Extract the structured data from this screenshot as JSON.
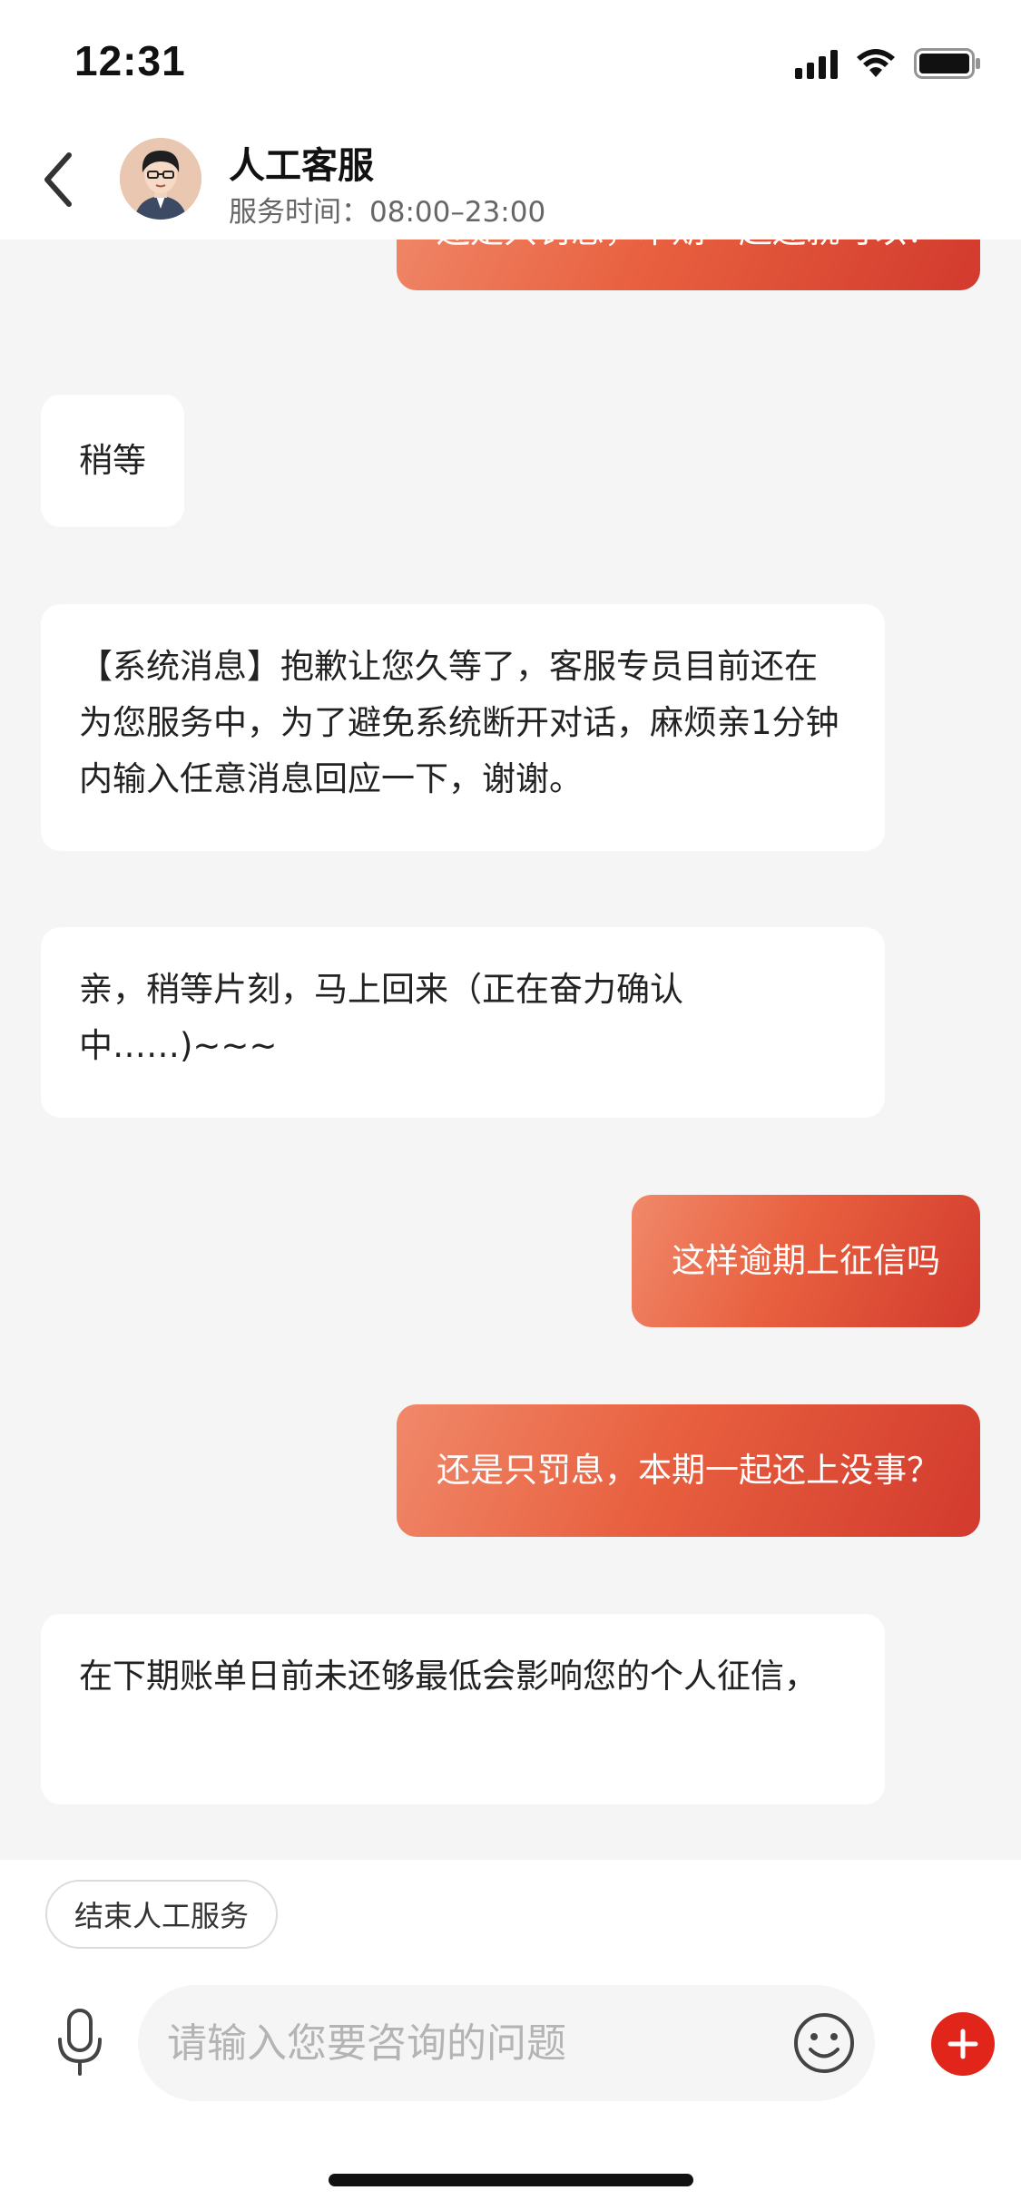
{
  "status_bar": {
    "time": "12:31"
  },
  "header": {
    "title": "人工客服",
    "service_hours": "服务时间：08:00–23:00"
  },
  "messages": [
    {
      "side": "right",
      "text": "还是只罚息，本期一起还就可以？"
    },
    {
      "side": "left",
      "text": "稍等"
    },
    {
      "side": "left",
      "text": "【系统消息】抱歉让您久等了，客服专员目前还在为您服务中，为了避免系统断开对话，麻烦亲1分钟内输入任意消息回应一下，谢谢。"
    },
    {
      "side": "left",
      "text": "亲，稍等片刻，马上回来（正在奋力确认中……)~~~"
    },
    {
      "side": "right",
      "text": "这样逾期上征信吗"
    },
    {
      "side": "right",
      "text": "还是只罚息，本期一起还上没事？"
    },
    {
      "side": "left",
      "text": "在下期账单日前未还够最低会影响您的个人征信，"
    }
  ],
  "bottom": {
    "end_service_label": "结束人工服务",
    "input_placeholder": "请输入您要咨询的问题"
  },
  "icons": {
    "back": "chevron-left-icon",
    "mic": "microphone-icon",
    "emoji": "smiley-icon",
    "plus": "plus-icon"
  },
  "colors": {
    "accent": "#e1251b",
    "bubble_gradient_start": "#f0896a",
    "bubble_gradient_end": "#d23a2d"
  }
}
